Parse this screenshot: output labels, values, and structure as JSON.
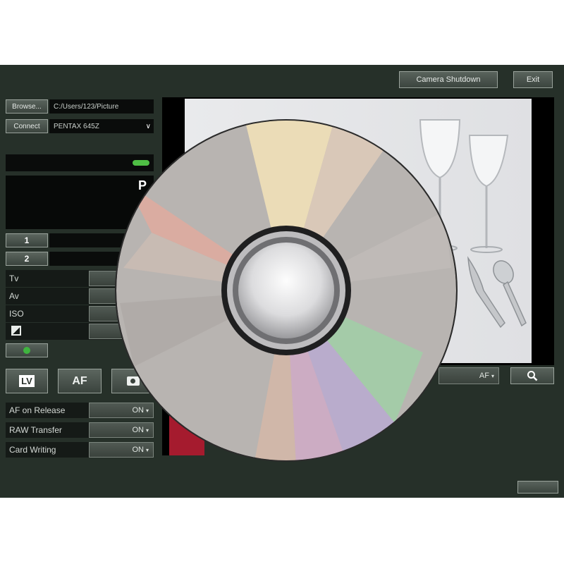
{
  "header": {
    "camera_shutdown_label": "Camera Shutdown",
    "exit_label": "Exit"
  },
  "connection": {
    "browse_label": "Browse...",
    "save_path": "C:/Users/123/Picture",
    "connect_label": "Connect",
    "camera_model": "PENTAX 645Z"
  },
  "status": {
    "indicator_color": "#4fbf45",
    "mode": "P"
  },
  "settings": {
    "tv_label": "Tv",
    "av_label": "Av",
    "iso_label": "ISO"
  },
  "actions": {
    "lv_label": "LV",
    "af_label": "AF"
  },
  "options": [
    {
      "label": "AF on Release",
      "value": "ON"
    },
    {
      "label": "RAW Transfer",
      "value": "ON"
    },
    {
      "label": "Card Writing",
      "value": "ON"
    }
  ],
  "preview": {
    "focus_dropdown": "AF"
  }
}
